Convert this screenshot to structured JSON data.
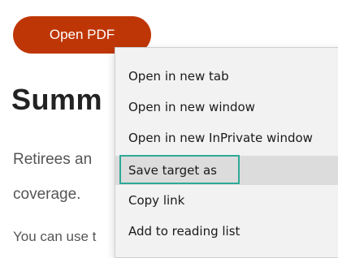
{
  "page": {
    "open_pdf_button": "Open PDF",
    "heading": "Summ",
    "paragraph_line1": "Retirees an",
    "paragraph_line2": "coverage.",
    "paragraph2": "You can use t"
  },
  "context_menu": {
    "items": [
      {
        "label": "Open in new tab"
      },
      {
        "label": "Open in new window"
      },
      {
        "label": "Open in new InPrivate window"
      },
      {
        "label": "Save target as",
        "highlighted": true
      },
      {
        "label": "Copy link"
      },
      {
        "label": "Add to reading list"
      }
    ]
  },
  "colors": {
    "button_background": "#bf3606",
    "focus_outline": "#2eaa97",
    "menu_background": "#f2f2f2",
    "menu_highlight": "#dcdcdc"
  }
}
